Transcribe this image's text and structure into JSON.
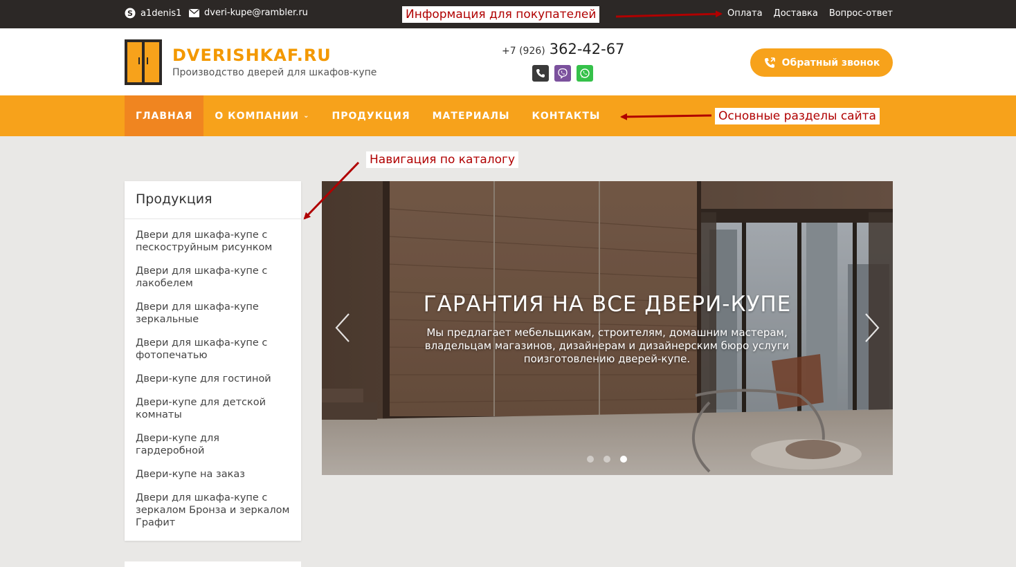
{
  "topbar": {
    "skype": "a1denis1",
    "email": "dveri-kupe@rambler.ru",
    "links": [
      "Оплата",
      "Доставка",
      "Вопрос-ответ"
    ]
  },
  "header": {
    "logo_title": "DVERISHKAF.RU",
    "logo_subtitle": "Производство дверей для шкафов-купе",
    "phone_code": "+7 (926)",
    "phone_number": "362-42-67",
    "callback_label": "Обратный звонок",
    "messengers": [
      "telephone-icon",
      "viber-icon",
      "whatsapp-icon"
    ]
  },
  "nav": {
    "items": [
      {
        "label": "ГЛАВНАЯ",
        "active": true
      },
      {
        "label": "О КОМПАНИИ",
        "dropdown": true
      },
      {
        "label": "ПРОДУКЦИЯ"
      },
      {
        "label": "МАТЕРИАЛЫ"
      },
      {
        "label": "КОНТАКТЫ"
      }
    ]
  },
  "annotations": {
    "buyers_info": "Информация для покупателей",
    "main_sections": "Основные разделы сайта",
    "catalog_nav": "Навигация по каталогу"
  },
  "sidebar": {
    "title": "Продукция",
    "items": [
      "Двери для шкафа-купе с пескоструйным рисунком",
      "Двери для шкафа-купе с лакобелем",
      "Двери для шкафа-купе зеркальные",
      "Двери для шкафа-купе с фотопечатью",
      "Двери-купе для гостиной",
      "Двери-купе для детской комнаты",
      "Двери-купе для гардеробной",
      "Двери-купе на заказ",
      "Двери для шкафа-купе с зеркалом Бронза и зеркалом Графит"
    ]
  },
  "slider": {
    "title": "ГАРАНТИЯ НА ВСЕ ДВЕРИ-КУПЕ",
    "text": "Мы предлагает мебельщикам, строителям, домашним мастерам, владельцам магазинов, дизайнерам и дизайнерским бюро услуги поизготовлению дверей-купе.",
    "slides_count": 3,
    "active_slide": 3
  },
  "colors": {
    "accent": "#f7a21b",
    "nav_active": "#f08520",
    "topbar": "#2c2826",
    "annotation": "#b00000"
  }
}
